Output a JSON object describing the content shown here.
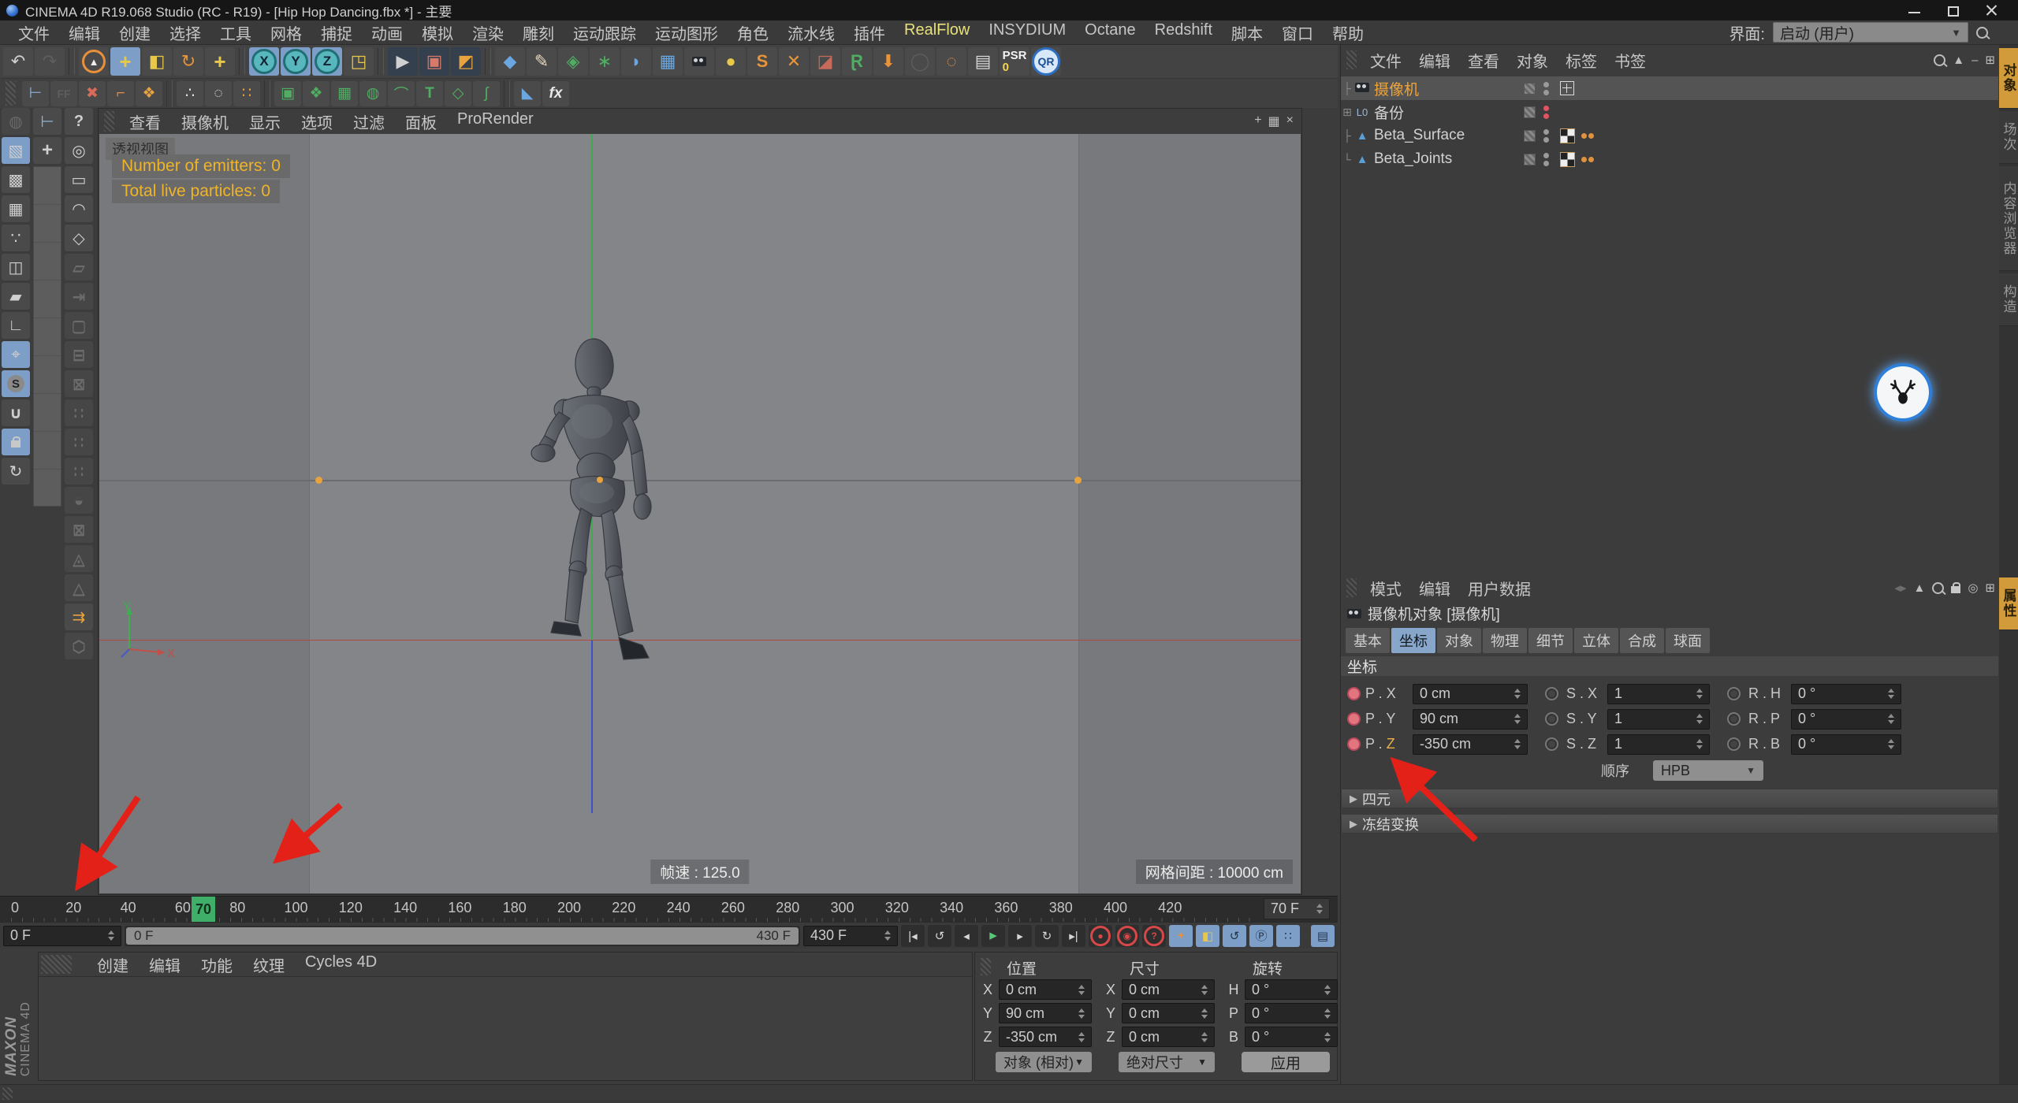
{
  "window": {
    "title": "CINEMA 4D R19.068 Studio (RC - R19) - [Hip Hop Dancing.fbx *] - 主要"
  },
  "menubar": {
    "items": [
      "文件",
      "编辑",
      "创建",
      "选择",
      "工具",
      "网格",
      "捕捉",
      "动画",
      "模拟",
      "渲染",
      "雕刻",
      "运动跟踪",
      "运动图形",
      "角色",
      "流水线",
      "插件",
      "RealFlow",
      "INSYDIUM",
      "Octane",
      "Redshift",
      "脚本",
      "窗口",
      "帮助"
    ],
    "accent_item": "RealFlow",
    "interface_label": "界面:",
    "interface_value": "启动 (用户)"
  },
  "toolbar": {
    "xyz": [
      "X",
      "Y",
      "Z"
    ],
    "sky_letter": "S",
    "psr_label": "PSR",
    "psr_zero": "0",
    "qr_label": "QR",
    "row2_t": "T",
    "row2_fx": "fx",
    "help_q": "?",
    "snap_s": "S"
  },
  "viewport": {
    "menu": [
      "查看",
      "摄像机",
      "显示",
      "选项",
      "过滤",
      "面板",
      "ProRender"
    ],
    "view_label": "透视视图",
    "overlay_lines": [
      "Number of emitters: 0",
      "Total live particles: 0"
    ],
    "framerate": "帧速 : 125.0",
    "grid_spacing": "网格间距 : 10000 cm",
    "axis_x": "X",
    "axis_y": "Y"
  },
  "object_manager": {
    "menu": [
      "文件",
      "编辑",
      "查看",
      "对象",
      "标签",
      "书签"
    ],
    "objects": [
      {
        "name": "摄像机"
      },
      {
        "name": "备份"
      },
      {
        "name": "Beta_Surface"
      },
      {
        "name": "Beta_Joints"
      }
    ],
    "null_icon_label": "L0",
    "side_tabs": [
      "对象",
      "场次",
      "内容浏览器",
      "构造"
    ]
  },
  "attribute_manager": {
    "menu": [
      "模式",
      "编辑",
      "用户数据"
    ],
    "title": "摄像机对象 [摄像机]",
    "tabs": [
      "基本",
      "坐标",
      "对象",
      "物理",
      "细节",
      "立体",
      "合成",
      "球面"
    ],
    "section": "坐标",
    "rows": [
      {
        "p_pre": "P . ",
        "p_letter": "X",
        "p_value": "0 cm",
        "s_label": "S . X",
        "s_value": "1",
        "r_label": "R . H",
        "r_value": "0 °"
      },
      {
        "p_pre": "P . ",
        "p_letter": "Y",
        "p_value": "90 cm",
        "s_label": "S . Y",
        "s_value": "1",
        "r_label": "R . P",
        "r_value": "0 °"
      },
      {
        "p_pre": "P . ",
        "p_letter": "Z",
        "p_value": "-350 cm",
        "s_label": "S . Z",
        "s_value": "1",
        "r_label": "R . B",
        "r_value": "0 °"
      }
    ],
    "order_label": "顺序",
    "order_value": "HPB",
    "collapsed_sections": [
      "四元",
      "冻结变换"
    ],
    "side_tab": "属性"
  },
  "timeline": {
    "ticks": [
      "0",
      "20",
      "40",
      "60",
      "80",
      "100",
      "120",
      "140",
      "160",
      "180",
      "200",
      "220",
      "240",
      "260",
      "280",
      "300",
      "320",
      "340",
      "360",
      "380",
      "400",
      "420"
    ],
    "playhead": "70",
    "current": "70 F",
    "start_field": "0 F",
    "range_left": "0 F",
    "range_right": "430 F",
    "end_field": "430 F"
  },
  "materials": {
    "menu": [
      "创建",
      "编辑",
      "功能",
      "纹理",
      "Cycles 4D"
    ],
    "logo_brand": "MAXON",
    "logo_product": "CINEMA 4D"
  },
  "coordinates": {
    "pos_title": "位置",
    "size_title": "尺寸",
    "rot_title": "旋转",
    "pos_rows": [
      {
        "k": "X",
        "v": "0 cm"
      },
      {
        "k": "Y",
        "v": "90 cm"
      },
      {
        "k": "Z",
        "v": "-350 cm"
      }
    ],
    "size_rows": [
      {
        "k": "X",
        "v": "0 cm"
      },
      {
        "k": "Y",
        "v": "0 cm"
      },
      {
        "k": "Z",
        "v": "0 cm"
      }
    ],
    "rot_rows": [
      {
        "k": "H",
        "v": "0 °"
      },
      {
        "k": "P",
        "v": "0 °"
      },
      {
        "k": "B",
        "v": "0 °"
      }
    ],
    "pos_mode": "对象 (相对)",
    "size_mode": "绝对尺寸",
    "apply_label": "应用"
  },
  "colors": {
    "accent_blue": "#7d9ec7",
    "amber": "#e0a23e",
    "arrow_red": "#e32119",
    "playhead_green": "#3fae68",
    "overlay_yellow": "#f0b428"
  }
}
